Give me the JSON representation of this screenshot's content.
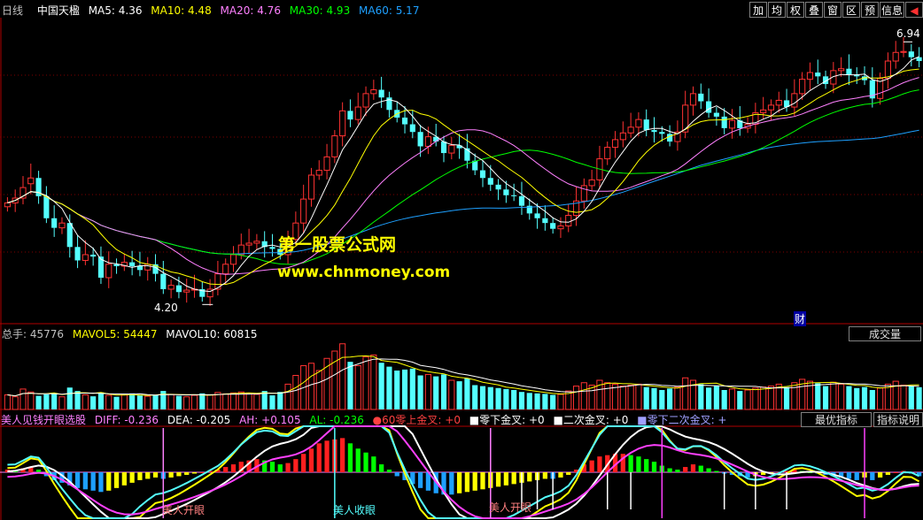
{
  "header": {
    "period": "日线",
    "stock_name": "中国天楹",
    "ma5": "MA5: 4.36",
    "ma10": "MA10: 4.48",
    "ma20": "MA20: 4.76",
    "ma30": "MA30: 4.93",
    "ma60": "MA60: 5.17"
  },
  "toolbar": {
    "buttons": [
      "加",
      "均",
      "权",
      "叠",
      "窗",
      "区",
      "预",
      "信息",
      "◀"
    ]
  },
  "price_panel": {
    "high_label": "6.94",
    "low_label": "4.20",
    "cai_marker": "财"
  },
  "watermark": {
    "line1": "第一股票公式网",
    "line2": "www.chnmoney.com"
  },
  "volume_panel": {
    "total": "总手: 45776",
    "mavol5": "MAVOL5: 54447",
    "mavol10": "MAVOL10: 60815",
    "button": "成交量"
  },
  "indicator_panel": {
    "name": "美人见钱开眼选股",
    "diff": "DIFF: -0.236",
    "dea": "DEA: -0.205",
    "ah": "AH: +0.105",
    "al": "AL: -0.236",
    "s1": "●60零上金叉: +0",
    "s2": "■零下金叉: +0",
    "s3": "■二次金叉: +0",
    "s4": "■零下二次金叉: +",
    "button1": "最优指标",
    "button2": "指标说明",
    "signals": [
      "美人开眼",
      "美人收眼",
      "美人开眼"
    ]
  },
  "colors": {
    "up": "#ff3232",
    "down": "#54ffff",
    "ma5": "#ffffff",
    "ma10": "#ffff00",
    "ma20": "#ff80ff",
    "ma30": "#00ff00",
    "ma60": "#1ea0ff",
    "grid": "#800000"
  },
  "chart_data": {
    "type": "candlestick",
    "count": 118,
    "ylim": [
      4.0,
      7.1
    ],
    "high_annotation": 6.94,
    "low_annotation": 4.2,
    "close": [
      5.26,
      5.31,
      5.42,
      5.52,
      5.33,
      5.1,
      5.0,
      5.05,
      4.8,
      4.66,
      4.72,
      4.7,
      4.48,
      4.62,
      4.6,
      4.64,
      4.6,
      4.56,
      4.62,
      4.52,
      4.36,
      4.4,
      4.33,
      4.35,
      4.36,
      4.28,
      4.36,
      4.52,
      4.62,
      4.72,
      4.82,
      4.84,
      4.86,
      4.8,
      4.78,
      4.72,
      4.88,
      5.05,
      5.3,
      5.55,
      5.6,
      5.74,
      5.96,
      6.22,
      6.13,
      6.26,
      6.4,
      6.44,
      6.36,
      6.23,
      6.15,
      6.08,
      6.0,
      5.85,
      5.95,
      5.9,
      5.78,
      5.86,
      5.83,
      5.7,
      5.6,
      5.52,
      5.45,
      5.4,
      5.34,
      5.33,
      5.23,
      5.15,
      5.1,
      5.05,
      4.99,
      5.02,
      5.13,
      5.28,
      5.44,
      5.5,
      5.72,
      5.84,
      5.92,
      5.99,
      6.05,
      6.13,
      6.02,
      6.0,
      5.98,
      5.9,
      6.0,
      6.28,
      6.4,
      6.32,
      6.2,
      6.16,
      6.04,
      6.12,
      6.04,
      6.08,
      6.2,
      6.23,
      6.28,
      6.33,
      6.26,
      6.4,
      6.55,
      6.62,
      6.58,
      6.5,
      6.64,
      6.66,
      6.6,
      6.58,
      6.54,
      6.35,
      6.56,
      6.74,
      6.83,
      6.84,
      6.78,
      6.74
    ],
    "open": [
      5.22,
      5.26,
      5.31,
      5.46,
      5.52,
      5.33,
      5.1,
      5.0,
      5.05,
      4.8,
      4.66,
      4.72,
      4.7,
      4.48,
      4.62,
      4.6,
      4.64,
      4.6,
      4.56,
      4.62,
      4.52,
      4.36,
      4.4,
      4.33,
      4.35,
      4.36,
      4.28,
      4.36,
      4.52,
      4.62,
      4.72,
      4.82,
      4.84,
      4.86,
      4.8,
      4.78,
      4.72,
      4.88,
      5.05,
      5.3,
      5.55,
      5.6,
      5.74,
      5.96,
      6.22,
      6.13,
      6.26,
      6.4,
      6.44,
      6.36,
      6.23,
      6.15,
      6.08,
      6.0,
      5.85,
      5.95,
      5.9,
      5.78,
      5.86,
      5.83,
      5.7,
      5.6,
      5.52,
      5.45,
      5.4,
      5.34,
      5.33,
      5.23,
      5.15,
      5.1,
      5.05,
      4.99,
      5.02,
      5.13,
      5.28,
      5.44,
      5.5,
      5.72,
      5.84,
      5.92,
      5.99,
      6.05,
      6.13,
      6.02,
      6.0,
      5.98,
      5.9,
      6.0,
      6.28,
      6.4,
      6.32,
      6.2,
      6.16,
      6.04,
      6.12,
      6.04,
      6.08,
      6.2,
      6.23,
      6.28,
      6.33,
      6.26,
      6.4,
      6.55,
      6.62,
      6.58,
      6.5,
      6.64,
      6.66,
      6.6,
      6.58,
      6.54,
      6.35,
      6.56,
      6.74,
      6.83,
      6.84,
      6.78
    ],
    "ma5_end": 4.36,
    "ma10_end": 4.48,
    "ma20_end": 4.76,
    "ma30_end": 4.93,
    "ma60_end": 5.17,
    "volume_ylim": [
      0,
      140000
    ],
    "volume": [
      30000,
      26000,
      42000,
      36000,
      28000,
      31000,
      33000,
      26000,
      45000,
      38000,
      30000,
      27000,
      35000,
      29000,
      26000,
      30000,
      33000,
      29000,
      27000,
      30000,
      38000,
      31000,
      28000,
      26000,
      29000,
      33000,
      30000,
      35000,
      32000,
      34000,
      36000,
      33000,
      31000,
      38000,
      29000,
      36000,
      52000,
      70000,
      90000,
      95000,
      80000,
      105000,
      120000,
      135000,
      98000,
      90000,
      108000,
      112000,
      96000,
      88000,
      80000,
      82000,
      84000,
      70000,
      72000,
      68000,
      72000,
      60000,
      58000,
      64000,
      50000,
      48000,
      46000,
      44000,
      42000,
      40000,
      36000,
      34000,
      33000,
      32000,
      30000,
      31000,
      38000,
      48000,
      55000,
      50000,
      60000,
      55000,
      52000,
      48000,
      50000,
      52000,
      46000,
      44000,
      40000,
      43000,
      46000,
      65000,
      60000,
      52000,
      45000,
      48000,
      40000,
      42000,
      38000,
      40000,
      44000,
      46000,
      48000,
      52000,
      46000,
      55000,
      62000,
      58000,
      54000,
      48000,
      56000,
      52000,
      48000,
      44000,
      46000,
      40000,
      44000,
      52000,
      58000,
      50000,
      48000,
      45776
    ],
    "mavol5_end": 54447,
    "mavol10_end": 60815,
    "macd_ylim": [
      -0.35,
      0.35
    ],
    "macd_bars": [
      0.02,
      0.01,
      0.03,
      0.04,
      0.02,
      -0.03,
      -0.06,
      -0.08,
      -0.1,
      -0.12,
      -0.13,
      -0.14,
      -0.15,
      -0.14,
      -0.12,
      -0.1,
      -0.08,
      -0.06,
      -0.05,
      -0.04,
      -0.05,
      -0.04,
      -0.03,
      -0.02,
      -0.01,
      0.0,
      0.01,
      0.02,
      0.04,
      0.06,
      0.08,
      0.09,
      0.1,
      0.09,
      0.08,
      0.06,
      0.07,
      0.1,
      0.14,
      0.18,
      0.22,
      0.24,
      0.25,
      0.26,
      0.22,
      0.18,
      0.15,
      0.12,
      0.06,
      0.02,
      -0.03,
      -0.06,
      -0.09,
      -0.12,
      -0.14,
      -0.16,
      -0.17,
      -0.17,
      -0.16,
      -0.15,
      -0.14,
      -0.13,
      -0.12,
      -0.11,
      -0.1,
      -0.09,
      -0.08,
      -0.07,
      -0.06,
      -0.05,
      -0.05,
      -0.04,
      -0.02,
      0.02,
      0.06,
      0.09,
      0.12,
      0.13,
      0.14,
      0.14,
      0.13,
      0.12,
      0.1,
      0.08,
      0.05,
      0.03,
      0.02,
      0.04,
      0.06,
      0.05,
      0.03,
      0.01,
      -0.01,
      -0.02,
      -0.03,
      -0.04,
      -0.03,
      -0.02,
      -0.01,
      0.0,
      0.01,
      0.02,
      0.01,
      0.0,
      -0.01,
      -0.02,
      -0.03,
      -0.04,
      -0.05,
      -0.06,
      -0.04,
      -0.06,
      -0.04,
      -0.02,
      0.0,
      0.01,
      -0.01,
      -0.03
    ],
    "series": [
      {
        "name": "DIFF",
        "end": -0.236
      },
      {
        "name": "DEA",
        "end": -0.205
      },
      {
        "name": "AH",
        "end": 0.105
      },
      {
        "name": "AL",
        "end": -0.236
      }
    ]
  }
}
